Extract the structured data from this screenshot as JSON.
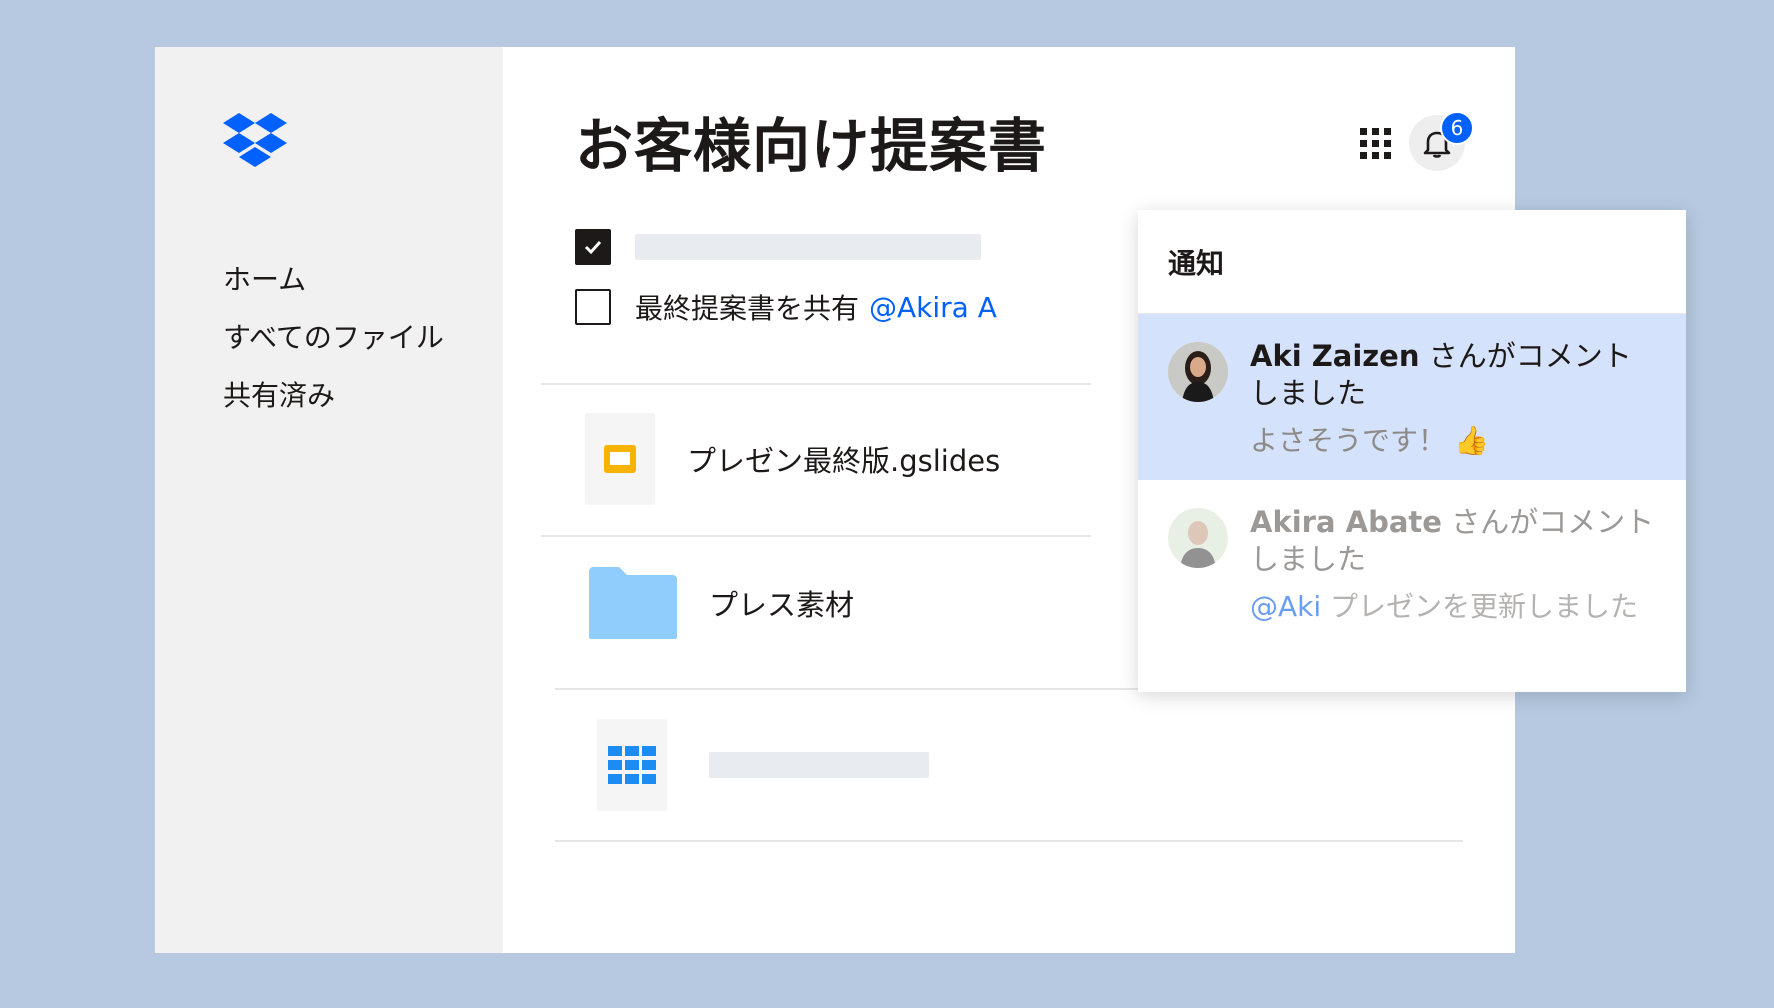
{
  "app": {
    "title": "お客様向け提案書",
    "brand_color": "#0061fe",
    "background_color": "#b6c9e1"
  },
  "sidebar": {
    "logo_icon": "dropbox-logo",
    "items": [
      {
        "label": "ホーム"
      },
      {
        "label": "すべてのファイル"
      },
      {
        "label": "共有済み"
      }
    ]
  },
  "header": {
    "apps_icon": "grid-icon",
    "bell_icon": "bell-icon",
    "notification_count": "6"
  },
  "tasks": [
    {
      "checked": true,
      "text": "",
      "mention": ""
    },
    {
      "checked": false,
      "text": "最終提案書を共有",
      "mention": "@Akira A"
    }
  ],
  "files": [
    {
      "name": "プレゼン最終版.gslides",
      "icon": "slides-icon"
    },
    {
      "name": "プレス素材",
      "icon": "folder-icon"
    },
    {
      "name": "",
      "icon": "spreadsheet-icon"
    }
  ],
  "notifications": {
    "title": "通知",
    "items": [
      {
        "name": "Aki Zaizen",
        "action": " さんがコメントしました",
        "message": "よさそうです！",
        "emoji": "👍",
        "active": true
      },
      {
        "name": "Akira Abate",
        "action": " さんがコメントしました",
        "mention": "@Aki",
        "message": " プレゼンを更新しました",
        "active": false
      }
    ]
  }
}
